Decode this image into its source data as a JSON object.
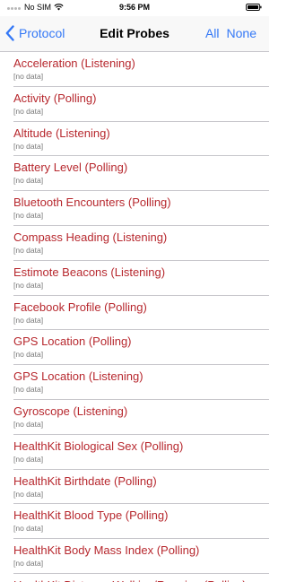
{
  "status_bar": {
    "carrier": "No SIM",
    "time": "9:56 PM"
  },
  "nav": {
    "back_label": "Protocol",
    "title": "Edit Probes",
    "all_label": "All",
    "none_label": "None"
  },
  "colors": {
    "accent": "#3478f6",
    "probe_text": "#b7282e",
    "status_text": "#777777",
    "separator": "#c8c7cc"
  },
  "probes": [
    {
      "name": "Acceleration (Listening)",
      "status": "[no data]"
    },
    {
      "name": "Activity (Polling)",
      "status": "[no data]"
    },
    {
      "name": "Altitude (Listening)",
      "status": "[no data]"
    },
    {
      "name": "Battery Level (Polling)",
      "status": "[no data]"
    },
    {
      "name": "Bluetooth Encounters (Polling)",
      "status": "[no data]"
    },
    {
      "name": "Compass Heading (Listening)",
      "status": "[no data]"
    },
    {
      "name": "Estimote Beacons (Listening)",
      "status": "[no data]"
    },
    {
      "name": "Facebook Profile (Polling)",
      "status": "[no data]"
    },
    {
      "name": "GPS Location (Polling)",
      "status": "[no data]"
    },
    {
      "name": "GPS Location (Listening)",
      "status": "[no data]"
    },
    {
      "name": "Gyroscope (Listening)",
      "status": "[no data]"
    },
    {
      "name": "HealthKit Biological Sex (Polling)",
      "status": "[no data]"
    },
    {
      "name": "HealthKit Birthdate (Polling)",
      "status": "[no data]"
    },
    {
      "name": "HealthKit Blood Type (Polling)",
      "status": "[no data]"
    },
    {
      "name": "HealthKit Body Mass Index (Polling)",
      "status": "[no data]"
    },
    {
      "name": "HealthKit Distance Walking/Running (Polling)",
      "status": ""
    }
  ]
}
